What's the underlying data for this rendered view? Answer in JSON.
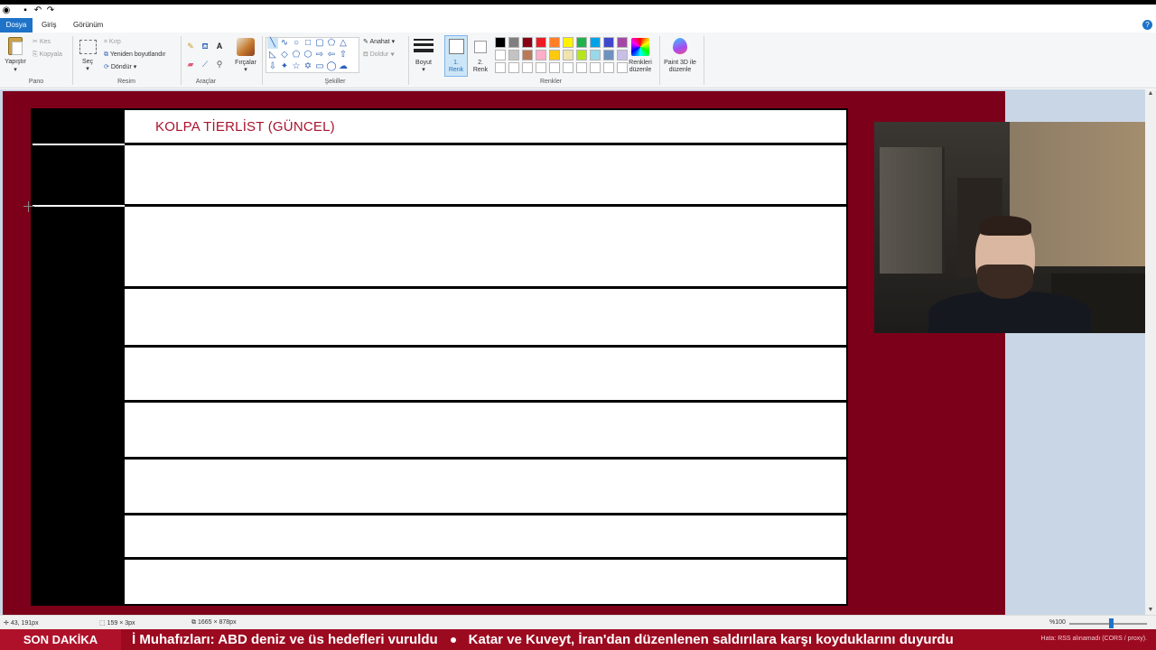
{
  "window": {
    "quick_access": [
      "save-icon",
      "undo-icon",
      "redo-icon"
    ]
  },
  "menu": {
    "tabs": [
      "Dosya",
      "Giriş",
      "Görünüm"
    ],
    "help": "?"
  },
  "ribbon": {
    "clipboard": {
      "paste": "Yapıştır",
      "cut": "Kes",
      "copy": "Kopyala",
      "group": "Pano"
    },
    "image": {
      "select": "Seç",
      "crop": "Kırp",
      "resize": "Yeniden boyutlandır",
      "rotate": "Döndür",
      "group": "Resim"
    },
    "tools": {
      "group": "Araçlar"
    },
    "brushes": {
      "label": "Fırçalar"
    },
    "shapes": {
      "outline": "Anahat",
      "fill": "Doldur",
      "group": "Şekiller"
    },
    "size": {
      "label": "Boyut"
    },
    "colors": {
      "color1_line1": "1.",
      "color1_line2": "Renk",
      "color2_line1": "2.",
      "color2_line2": "Renk",
      "edit_line1": "Renkleri",
      "edit_line2": "düzenle",
      "p3d_line1": "Paint 3D ile",
      "p3d_line2": "düzenle",
      "group": "Renkler",
      "palette_row1": [
        "#000000",
        "#7f7f7f",
        "#880015",
        "#ed1c24",
        "#ff7f27",
        "#fff200",
        "#22b14c",
        "#00a2e8",
        "#3f48cc",
        "#a349a4"
      ],
      "palette_row2": [
        "#ffffff",
        "#c3c3c3",
        "#b97a57",
        "#ffaec9",
        "#ffc90e",
        "#efe4b0",
        "#b5e61d",
        "#99d9ea",
        "#7092be",
        "#c8bfe7"
      ],
      "palette_row3": [
        "#ffffff",
        "#ffffff",
        "#ffffff",
        "#ffffff",
        "#ffffff",
        "#ffffff",
        "#ffffff",
        "#ffffff",
        "#ffffff",
        "#ffffff"
      ]
    }
  },
  "canvas": {
    "title": "KOLPA TİERLİST (GÜNCEL)",
    "title_color": "#a8132d",
    "background_color": "#7c0019"
  },
  "status": {
    "cursor_pos": "43, 191px",
    "selection_size": "159 × 3px",
    "canvas_size": "1665 × 878px",
    "zoom": "%100"
  },
  "ticker": {
    "label": "SON DAKİKA",
    "items": [
      "İ Muhafızları: ABD deniz ve üs hedefleri vuruldu",
      "Katar ve Kuveyt, İran'dan düzenlenen saldırılara karşı koyduklarını duyurdu"
    ],
    "error": "Hata: RSS alınamadı (CORS / proxy)."
  }
}
